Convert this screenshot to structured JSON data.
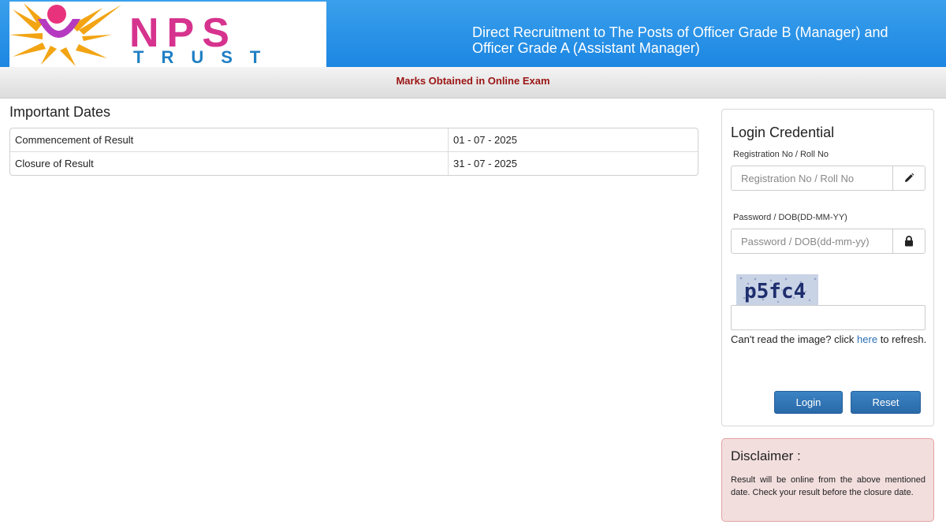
{
  "header": {
    "logo_text_top": "NPS",
    "logo_text_bottom": "TRUST",
    "title": "Direct Recruitment to The Posts of Officer Grade B (Manager) and Officer Grade A (Assistant Manager)"
  },
  "subbar": {
    "text": "Marks Obtained in Online Exam"
  },
  "important_dates": {
    "heading": "Important Dates",
    "rows": [
      {
        "label": "Commencement of Result",
        "value": "01 - 07 - 2025"
      },
      {
        "label": "Closure of Result",
        "value": "31 - 07 - 2025"
      }
    ]
  },
  "login": {
    "title": "Login Credential",
    "reg_label": "Registration No / Roll No",
    "reg_placeholder": "Registration No / Roll No",
    "pwd_label": "Password / DOB(DD-MM-YY)",
    "pwd_placeholder": "Password / DOB(dd-mm-yy)",
    "captcha_text": "p5fc4",
    "captcha_help_prefix": "Can't read the image? click",
    "captcha_help_link": "here",
    "captcha_help_suffix": "to refresh.",
    "login_button": "Login",
    "reset_button": "Reset"
  },
  "disclaimer": {
    "title": "Disclaimer :",
    "text": "Result will be online from the above mentioned date. Check your result before the closure date."
  },
  "colors": {
    "header_blue": "#1c86e2",
    "subbar_text": "#9b1414",
    "button_blue": "#2a6aa9",
    "disclaimer_bg": "#f3dede",
    "link": "#2a6fb4"
  },
  "icons": {
    "reg_addon": "pencil-icon",
    "pwd_addon": "lock-icon"
  }
}
